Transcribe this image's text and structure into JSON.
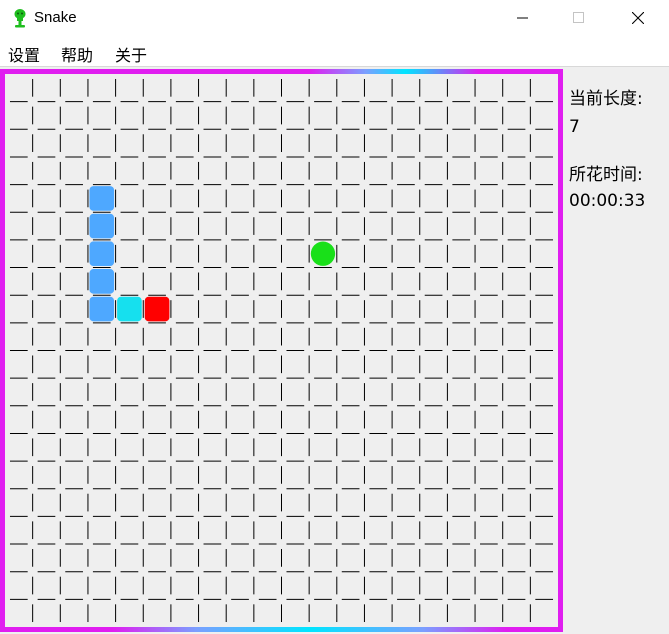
{
  "window": {
    "title": "Snake",
    "icon": "green-figure-icon",
    "controls": [
      "minimize-icon",
      "maximize-icon",
      "close-icon"
    ]
  },
  "menu": [
    {
      "label": "设置"
    },
    {
      "label": "帮助"
    },
    {
      "label": "关于"
    }
  ],
  "stats": {
    "length_label": "当前长度:",
    "length_value": "7",
    "time_label": "所花时间:",
    "time_value": "00:00:33"
  },
  "game": {
    "grid_size": 20,
    "snake_segments": [
      {
        "col": 3,
        "row": 4
      },
      {
        "col": 3,
        "row": 5
      },
      {
        "col": 3,
        "row": 6
      },
      {
        "col": 3,
        "row": 7
      },
      {
        "col": 3,
        "row": 8
      },
      {
        "col": 4,
        "row": 8
      },
      {
        "col": 5,
        "row": 8
      }
    ],
    "food": {
      "col": 11,
      "row": 6
    },
    "colors": {
      "snake_body": "#4ea8ff",
      "snake_neck": "#16e0ee",
      "snake_head": "#ff0000",
      "food": "#19e019",
      "border_main": "#e01ef0",
      "border_accent": "#00e5ff",
      "grid_line": "#000000"
    }
  }
}
